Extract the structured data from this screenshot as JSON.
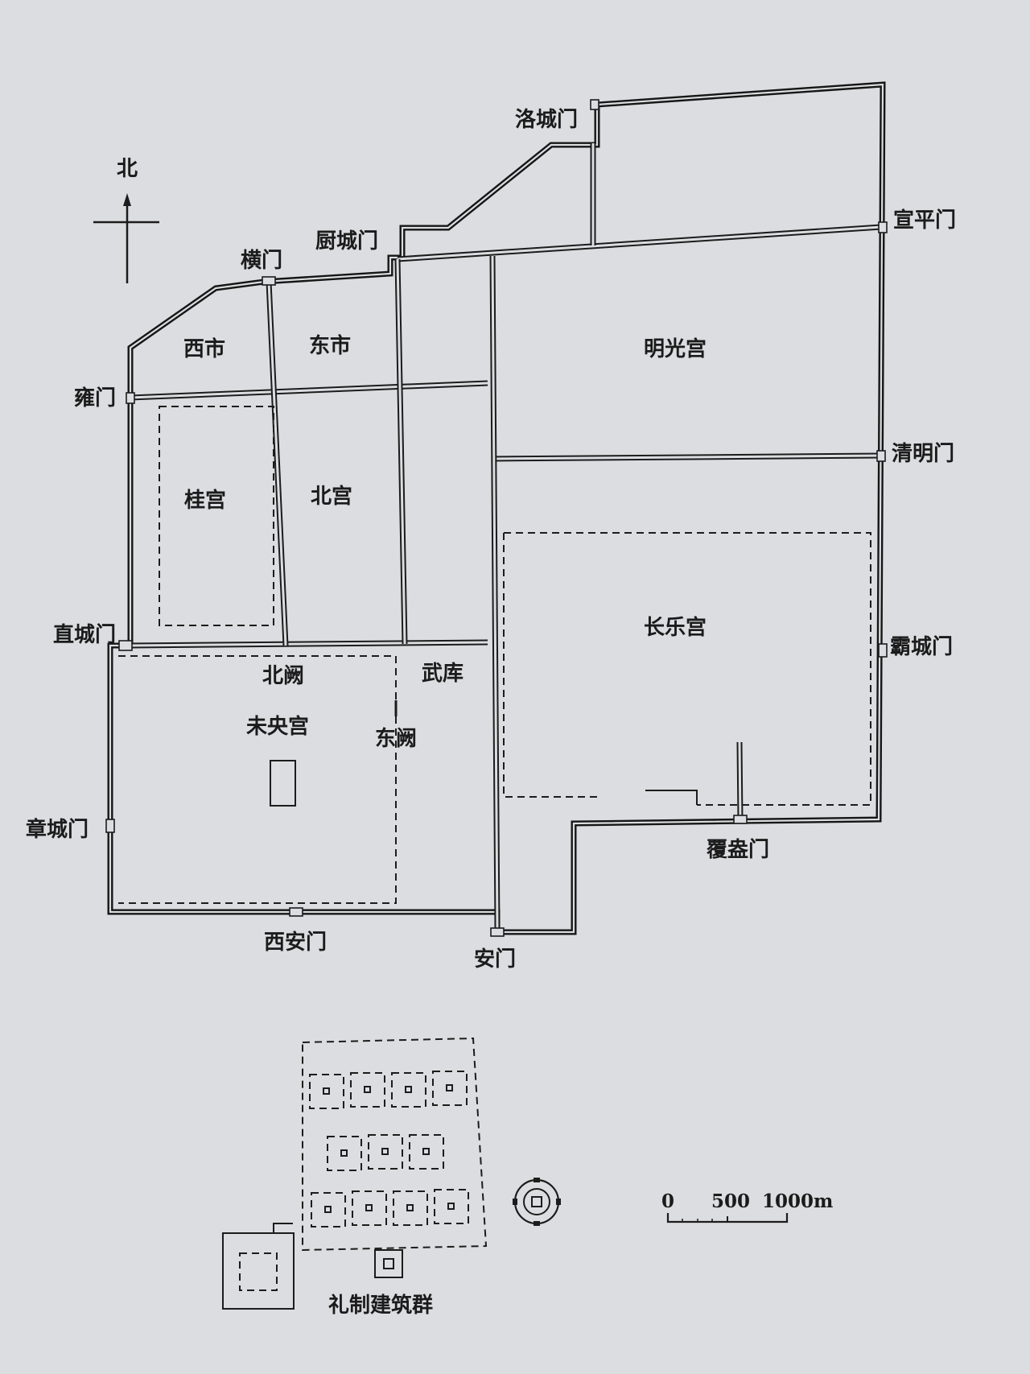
{
  "map": {
    "north_label": "北",
    "gates": {
      "luocheng": "洛城门",
      "xuanping": "宣平门",
      "chucheng": "厨城门",
      "heng": "横门",
      "yong": "雍门",
      "qingming": "清明门",
      "zhicheng": "直城门",
      "bacheng": "霸城门",
      "zhangcheng": "章城门",
      "fuang": "覆盎门",
      "xian": "西安门",
      "an": "安门"
    },
    "areas": {
      "xishi": "西市",
      "dongshi": "东市",
      "mingguang": "明光宫",
      "gui": "桂宫",
      "bei": "北宫",
      "changle": "长乐宫",
      "weiyang": "未央宫",
      "wuku": "武库",
      "beique": "北阙",
      "dongque": "东阙"
    },
    "ritual_label": "礼制建筑群",
    "scale": {
      "ticks": [
        "0",
        "500",
        "1000m"
      ]
    },
    "colors": {
      "paper": "#dcdde0",
      "ink": "#1b1b1b"
    }
  }
}
